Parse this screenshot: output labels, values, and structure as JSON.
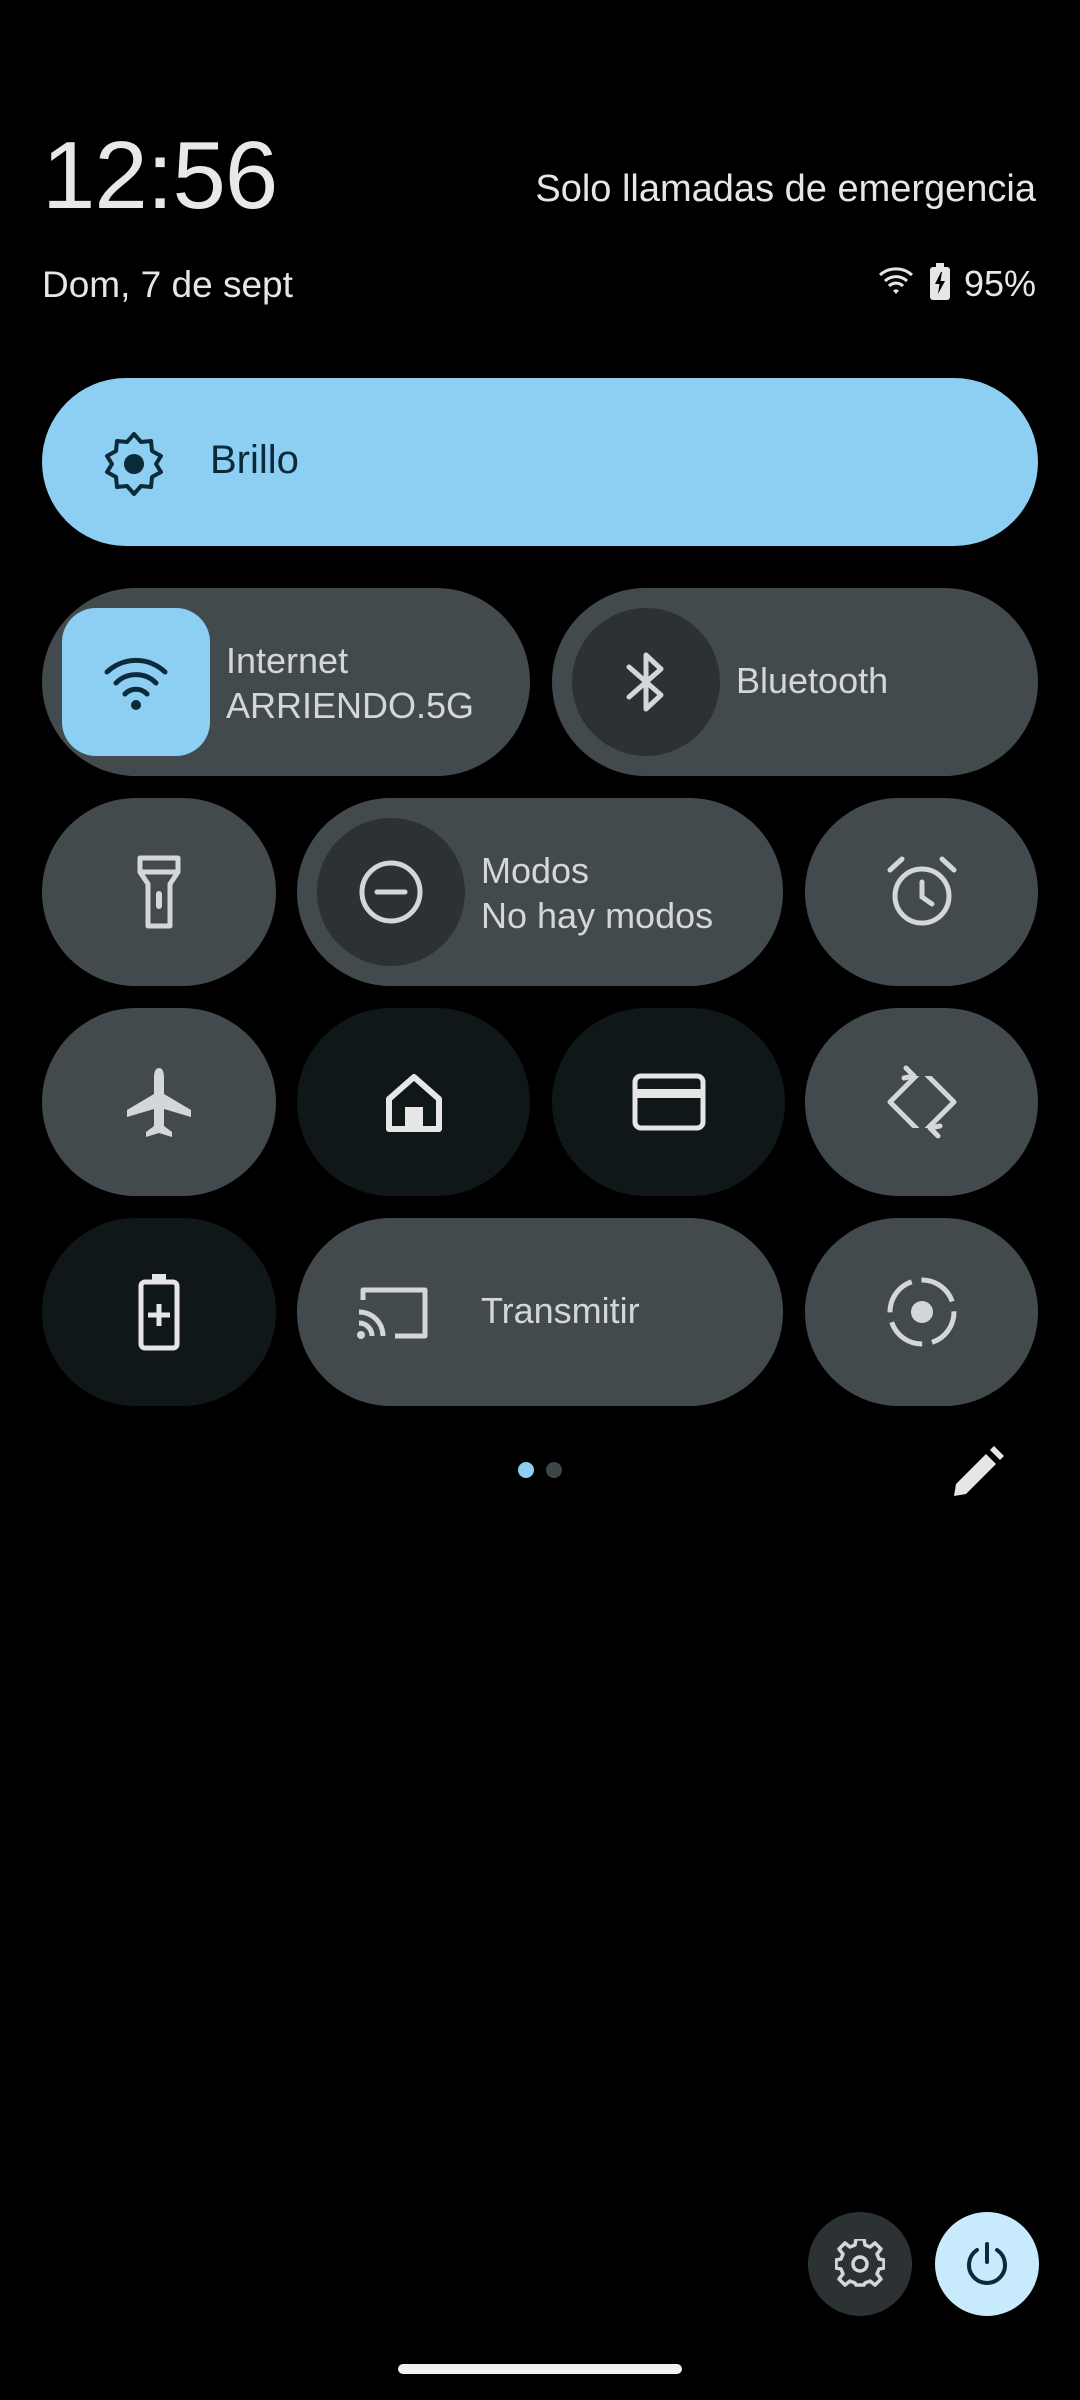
{
  "status": {
    "time": "12:56",
    "carrier_text": "Solo llamadas de emergencia",
    "date": "Dom, 7 de sept",
    "battery_percent": "95%",
    "wifi_icon": "wifi-icon",
    "battery_icon": "battery-charging-icon"
  },
  "brightness": {
    "label": "Brillo",
    "icon": "brightness-icon"
  },
  "tiles": {
    "internet": {
      "label": "Internet",
      "sublabel": "ARRIENDO.5G",
      "icon": "wifi-icon",
      "active": true
    },
    "bluetooth": {
      "label": "Bluetooth",
      "icon": "bluetooth-icon",
      "active": false
    },
    "flashlight": {
      "icon": "flashlight-icon",
      "active": false
    },
    "modes": {
      "label": "Modos",
      "sublabel": "No hay modos",
      "icon": "do-not-disturb-icon",
      "active": false
    },
    "alarm": {
      "icon": "alarm-icon",
      "active": false
    },
    "airplane": {
      "icon": "airplane-icon",
      "active": false
    },
    "home": {
      "icon": "home-icon",
      "active": false
    },
    "wallet": {
      "icon": "card-icon",
      "active": false
    },
    "rotate": {
      "icon": "auto-rotate-icon",
      "active": false
    },
    "battery_saver": {
      "icon": "battery-saver-icon",
      "active": false
    },
    "cast": {
      "label": "Transmitir",
      "icon": "cast-icon",
      "active": false
    },
    "screen_record": {
      "icon": "screen-record-icon",
      "active": false
    }
  },
  "pager": {
    "pages": 2,
    "current": 1
  },
  "colors": {
    "accent": "#8ccff2",
    "tile_bg": "#434a4d",
    "tile_dark_bg": "#101719",
    "background": "#000000"
  }
}
